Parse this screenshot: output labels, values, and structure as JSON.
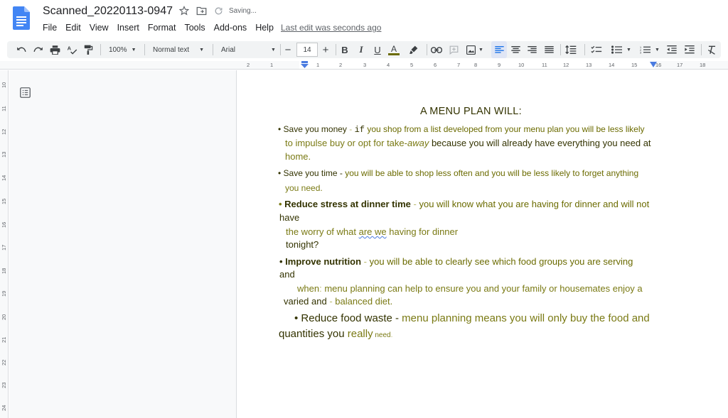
{
  "app": {
    "doc_title": "Scanned_20220113-0947",
    "save_status": "Saving...",
    "last_edit": "Last edit was seconds ago",
    "menu": [
      "File",
      "Edit",
      "View",
      "Insert",
      "Format",
      "Tools",
      "Add-ons",
      "Help"
    ]
  },
  "toolbar": {
    "zoom": "100%",
    "style": "Normal text",
    "font": "Arial",
    "font_size": "14",
    "minus": "−",
    "plus": "+",
    "bold": "B",
    "italic": "I",
    "underline": "U",
    "text_color": "A"
  },
  "ruler": {
    "top_ticks": [
      "2",
      "1",
      "1",
      "2",
      "3",
      "4",
      "5",
      "6",
      "7",
      "8",
      "9",
      "10",
      "11",
      "12",
      "13",
      "14",
      "15",
      "16",
      "17",
      "18"
    ],
    "left_ticks": [
      "10",
      "11",
      "12",
      "13",
      "14",
      "15",
      "16",
      "17",
      "18",
      "19",
      "20",
      "21",
      "22",
      "23",
      "24"
    ]
  },
  "document": {
    "heading": "A MENU PLAN WILL:",
    "p1": {
      "l1_a": "• Save you money",
      "l1_b": " - ",
      "l1_c": "if",
      "l1_d": " you shop from a list developed from your menu plan you will be less likely",
      "l2_a": "to impulse buy or opt for take-",
      "l2_b": "away",
      "l2_c": " because you will already have everything you need at",
      "l3": "home."
    },
    "p2": {
      "l1_a": "• Save you time - ",
      "l1_b": "you will be able to shop less often and you will be less likely to forget anything",
      "l2": "you need."
    },
    "p3": {
      "l1_a": "• ",
      "l1_b": "Reduce stress at dinner time",
      "l1_c": " - ",
      "l1_d": "you will know what you are having for dinner and will not",
      "l2": "have",
      "l3_a": "the worry of what ",
      "l3_b": "are we",
      "l3_c": " having for dinner",
      "l4": "tonight?"
    },
    "p4": {
      "l1_a": "• ",
      "l1_b": "Improve nutrition",
      "l1_c": " - ",
      "l1_d": "you will be able to clearly see which food groups you are serving",
      "l2": "and",
      "l3_a": "when",
      "l3_b": ": ",
      "l3_c": "menu planning can help to ensure you and your family or housemates enjoy a",
      "l4_a": "varied and",
      "l4_b": " - ",
      "l4_c": "balanced diet."
    },
    "p5": {
      "l1_a": "• Reduce food waste - ",
      "l1_b": "menu planning means you will only buy the food and",
      "l2_a": "quantities you ",
      "l2_b": "really",
      "l2_c": " need",
      "l2_d": "."
    }
  }
}
